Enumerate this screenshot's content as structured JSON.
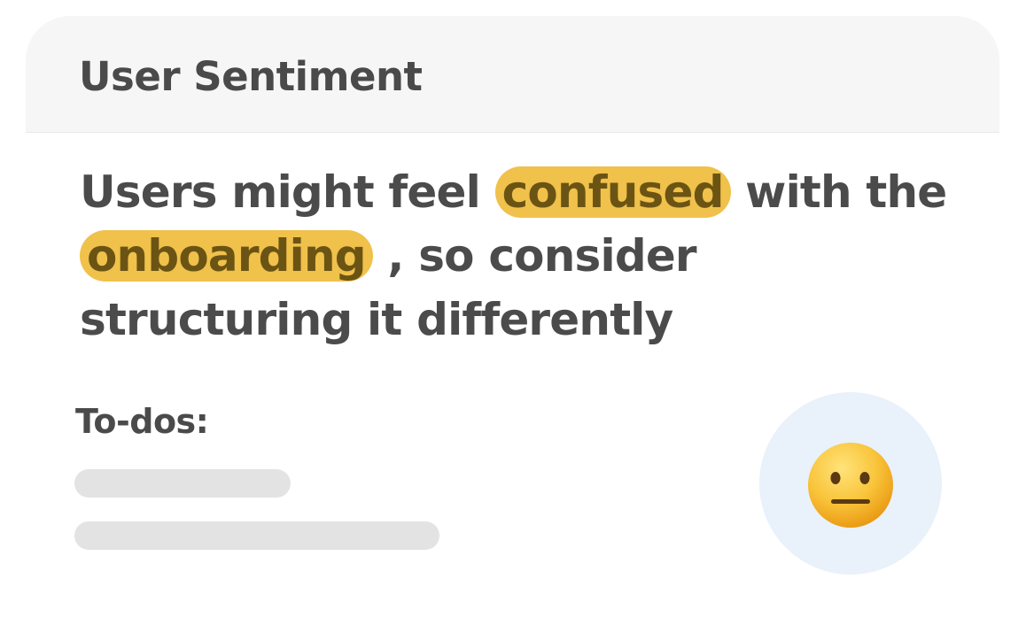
{
  "card": {
    "title": "User Sentiment"
  },
  "sentiment": {
    "before_word1": "Users might feel",
    "highlight_word1": "confused",
    "between": "with the",
    "highlight_word2": "onboarding",
    "after_word2": ", so consider structuring it differently"
  },
  "todos": {
    "label": "To-dos:"
  },
  "emoji": {
    "icon": "neutral-face-icon"
  },
  "colors": {
    "header_bg": "#f6f6f6",
    "highlight": "#f0c14b",
    "text": "#4b4b4b",
    "emoji_circle": "#e9f1fb",
    "placeholder_bar": "#e3e3e3"
  }
}
